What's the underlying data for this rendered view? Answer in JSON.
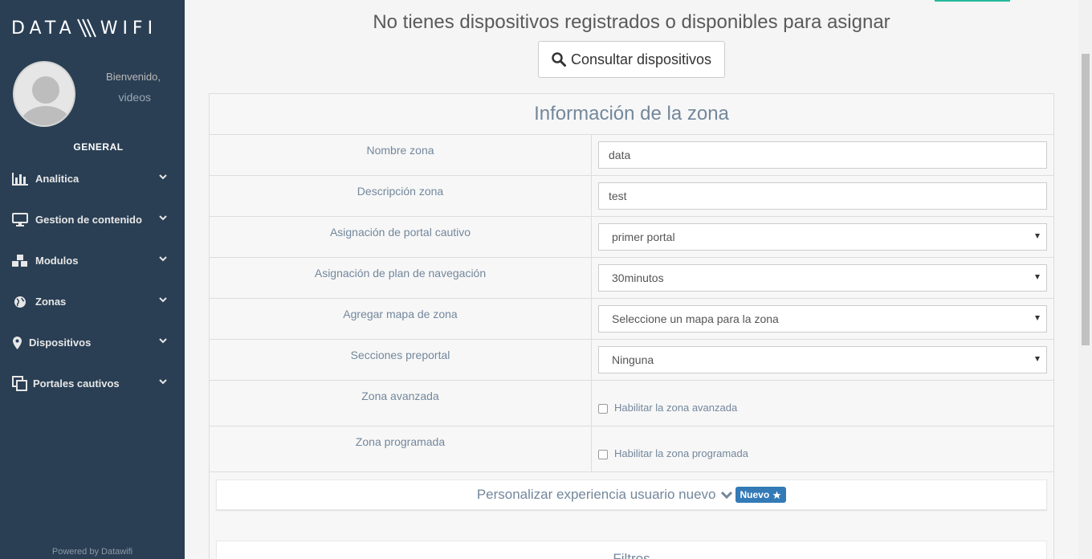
{
  "brand": {
    "left": "DATA",
    "right": "WIFI"
  },
  "user": {
    "welcome": "Bienvenido,",
    "name": "videos"
  },
  "sidebar": {
    "section_title": "GENERAL",
    "items": [
      {
        "label": "Analitica",
        "icon": "bar-chart-icon"
      },
      {
        "label": "Gestion de contenido",
        "icon": "desktop-icon"
      },
      {
        "label": "Modulos",
        "icon": "cubes-icon"
      },
      {
        "label": "Zonas",
        "icon": "globe-icon"
      },
      {
        "label": "Dispositivos",
        "icon": "map-marker-icon"
      },
      {
        "label": "Portales cautivos",
        "icon": "clone-icon"
      }
    ],
    "powered": "Powered by Datawifi"
  },
  "main": {
    "title": "No tienes dispositivos registrados o disponibles para asignar",
    "consult_button": "Consultar dispositivos",
    "panel_title": "Información de la zona",
    "fields": {
      "zone_name": {
        "label": "Nombre zona",
        "value": "data"
      },
      "zone_description": {
        "label": "Descripción zona",
        "value": "test"
      },
      "captive_portal": {
        "label": "Asignación de portal cautivo",
        "value": "primer portal"
      },
      "nav_plan": {
        "label": "Asignación de plan de navegación",
        "value": "30minutos"
      },
      "zone_map": {
        "label": "Agregar mapa de zona",
        "value": "Seleccione un mapa para la zona"
      },
      "preportal": {
        "label": "Secciones preportal",
        "value": "Ninguna"
      },
      "advanced": {
        "label": "Zona avanzada",
        "checkbox_label": "Habilitar la zona avanzada",
        "checked": false
      },
      "scheduled": {
        "label": "Zona programada",
        "checkbox_label": "Habilitar la zona programada",
        "checked": false
      }
    },
    "customize": {
      "label": "Personalizar experiencia usuario nuevo",
      "badge": "Nuevo"
    },
    "filters": {
      "label": "Filtros"
    }
  },
  "colors": {
    "sidebar": "#2a3f54",
    "accent": "#26b99a",
    "badge": "#337ab7",
    "label_text": "#73879c"
  }
}
